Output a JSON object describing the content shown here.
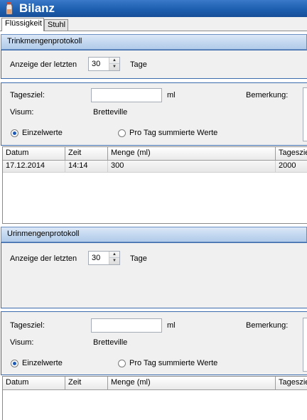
{
  "window": {
    "title": "Bilanz"
  },
  "tabs": [
    {
      "label": "Flüssigkeit",
      "active": true
    },
    {
      "label": "Stuhl",
      "active": false
    }
  ],
  "drink": {
    "header": "Trinkmengenprotokoll",
    "show_last_label": "Anzeige der letzten",
    "show_last_value": "30",
    "days_label": "Tage",
    "daily_goal_label": "Tagesziel:",
    "daily_goal_value": "",
    "unit": "ml",
    "remark_label": "Bemerkung:",
    "visum_label": "Visum:",
    "visum_value": "Bretteville",
    "radio_single": "Einzelwerte",
    "radio_summed": "Pro Tag summierte Werte",
    "selected_mode": "Einzelwerte",
    "columns": [
      "Datum",
      "Zeit",
      "Menge (ml)",
      "Tagesziel"
    ],
    "rows": [
      [
        "17.12.2014",
        "14:14",
        "300",
        "2000"
      ]
    ]
  },
  "urine": {
    "header": "Urinmengenprotokoll",
    "show_last_label": "Anzeige der letzten",
    "show_last_value": "30",
    "days_label": "Tage",
    "daily_goal_label": "Tagesziel:",
    "daily_goal_value": "",
    "unit": "ml",
    "remark_label": "Bemerkung:",
    "visum_label": "Visum:",
    "visum_value": "Bretteville",
    "radio_single": "Einzelwerte",
    "radio_summed": "Pro Tag summierte Werte",
    "selected_mode": "Einzelwerte",
    "columns": [
      "Datum",
      "Zeit",
      "Menge (ml)",
      "Tagesziel"
    ],
    "rows": []
  },
  "colors": {
    "titlebar": "#1d5fb0",
    "section_header": "#c4d8f0",
    "radio_selected": "#1f5bb5"
  }
}
